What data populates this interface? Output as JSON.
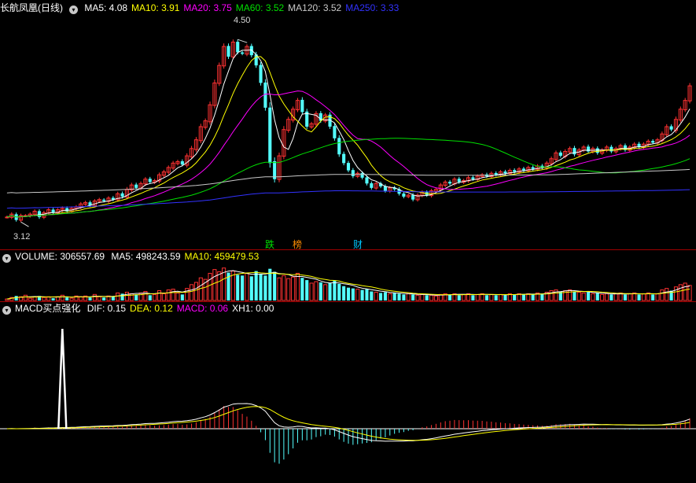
{
  "price_header": {
    "title": "长航凤凰(日线)",
    "items": [
      {
        "label": "MA5: 4.08",
        "color": "#ffffff"
      },
      {
        "label": "MA10: 3.91",
        "color": "#ffff00"
      },
      {
        "label": "MA20: 3.75",
        "color": "#ff00ff"
      },
      {
        "label": "MA60: 3.52",
        "color": "#00e000"
      },
      {
        "label": "MA120: 3.52",
        "color": "#c8c8c8"
      },
      {
        "label": "MA250: 3.33",
        "color": "#3232ff"
      }
    ]
  },
  "volume_header": {
    "title": "VOLUME: 306557.69",
    "items": [
      {
        "label": "MA5: 498243.59",
        "color": "#ffffff"
      },
      {
        "label": "MA10: 459479.53",
        "color": "#ffff00"
      }
    ]
  },
  "macd_header": {
    "title": "MACD买点强化",
    "items": [
      {
        "label": "DIF: 0.15",
        "color": "#ffffff"
      },
      {
        "label": "DEA: 0.12",
        "color": "#ffff00"
      },
      {
        "label": "MACD: 0.06",
        "color": "#ff00ff"
      },
      {
        "label": "XH1: 0.00",
        "color": "#ffffff"
      }
    ]
  },
  "annotations": {
    "high": "4.50",
    "low": "3.12"
  },
  "events": [
    {
      "label": "跌",
      "color": "#00e000",
      "day": 57
    },
    {
      "label": "榜",
      "color": "#ff8c00",
      "day": 63
    },
    {
      "label": "财",
      "color": "#00c8ff",
      "day": 76
    }
  ],
  "colors": {
    "up": "#ff3232",
    "down": "#54ffff",
    "grid": "#a00000"
  },
  "chart_data": {
    "type": "candlestick",
    "seed": [
      [
        3.18,
        0,
        0.2,
        0,
        0
      ],
      [
        3.2,
        0.3,
        0.4,
        0,
        0
      ],
      [
        3.16,
        -0.2,
        0.6,
        0,
        0
      ],
      [
        3.19,
        0.3,
        0.5,
        0,
        0
      ],
      [
        3.19,
        0,
        0.7,
        0,
        0
      ],
      [
        3.2,
        0.2,
        0.3,
        0,
        0
      ],
      [
        3.22,
        0.3,
        0.5,
        0,
        0
      ],
      [
        3.18,
        -0.3,
        0.6,
        0,
        0
      ],
      [
        3.21,
        0.3,
        0.4,
        0,
        0
      ],
      [
        3.23,
        0.4,
        0.5,
        0,
        0
      ],
      [
        3.21,
        -0.2,
        0.3,
        0,
        0
      ],
      [
        3.23,
        0.2,
        0.5,
        0,
        0
      ],
      [
        3.24,
        0.3,
        0.7,
        0,
        0
      ],
      [
        3.22,
        -0.2,
        0.4,
        0,
        0
      ],
      [
        3.24,
        0.3,
        0.3,
        0,
        0
      ],
      [
        3.25,
        0.2,
        0.6,
        0,
        0
      ],
      [
        3.27,
        0.3,
        0.5,
        0,
        0
      ],
      [
        3.28,
        0.2,
        0.6,
        0,
        0
      ],
      [
        3.26,
        -0.2,
        0.4,
        0,
        0
      ],
      [
        3.29,
        0.3,
        0.8,
        0,
        0
      ],
      [
        3.3,
        0.2,
        0.5,
        0,
        0
      ],
      [
        3.29,
        0,
        0.4,
        0,
        0
      ],
      [
        3.31,
        0.3,
        0.6,
        0,
        0
      ],
      [
        3.3,
        -0.2,
        0.5,
        0,
        0
      ],
      [
        3.34,
        0.4,
        1.0,
        0,
        0
      ],
      [
        3.32,
        -0.3,
        0.9,
        0,
        0
      ],
      [
        3.37,
        0.6,
        1.1,
        0,
        0
      ],
      [
        3.4,
        0.5,
        0.9,
        0,
        0
      ],
      [
        3.38,
        -0.3,
        0.8,
        0,
        0
      ],
      [
        3.41,
        0.4,
        1.0,
        0,
        0
      ],
      [
        3.44,
        0.4,
        1.2,
        0,
        0
      ],
      [
        3.42,
        -0.3,
        0.7,
        0,
        0
      ],
      [
        3.43,
        0.2,
        0.8,
        0,
        0
      ],
      [
        3.47,
        0.5,
        1.3,
        0,
        0
      ],
      [
        3.49,
        0.4,
        0.9,
        0,
        0
      ],
      [
        3.52,
        0.4,
        1.4,
        0,
        0
      ],
      [
        3.55,
        0.5,
        1.5,
        0,
        0
      ],
      [
        3.56,
        0.3,
        1.0,
        0,
        0
      ],
      [
        3.54,
        -0.3,
        0.8,
        0,
        0
      ],
      [
        3.6,
        0.7,
        1.6,
        0,
        0
      ],
      [
        3.65,
        0.8,
        2.1,
        0,
        0
      ],
      [
        3.71,
        0.9,
        2.4,
        0,
        0
      ],
      [
        3.8,
        1.0,
        3.0,
        0,
        0
      ],
      [
        3.84,
        0.6,
        2.8,
        0,
        0
      ],
      [
        3.95,
        1.2,
        3.6,
        0,
        0
      ],
      [
        4.1,
        1.3,
        4.1,
        0,
        0
      ],
      [
        4.22,
        1.0,
        3.8,
        0,
        0
      ],
      [
        4.35,
        1.1,
        4.3,
        0,
        0
      ],
      [
        4.28,
        -0.7,
        3.7,
        0,
        0
      ],
      [
        4.38,
        0.8,
        3.9,
        0,
        0
      ],
      [
        4.31,
        -0.6,
        3.4,
        0,
        0
      ],
      [
        4.3,
        0,
        3.3,
        0,
        0
      ],
      [
        4.35,
        0.5,
        3.6,
        0,
        0
      ],
      [
        4.29,
        -0.6,
        3.2,
        0,
        0
      ],
      [
        4.22,
        -0.8,
        3.9,
        0,
        0
      ],
      [
        4.1,
        -1.0,
        3.5,
        0,
        0
      ],
      [
        3.93,
        -1.3,
        3.3,
        0,
        0
      ],
      [
        3.55,
        -2.6,
        4.2,
        0,
        0
      ],
      [
        3.44,
        -1.6,
        3.8,
        0,
        0
      ],
      [
        3.6,
        1.2,
        3.0,
        0,
        0
      ],
      [
        3.78,
        1.4,
        3.3,
        0,
        0
      ],
      [
        3.85,
        0.8,
        2.9,
        0,
        0
      ],
      [
        3.92,
        0.8,
        3.1,
        0,
        0
      ],
      [
        3.98,
        0.7,
        3.6,
        0,
        0
      ],
      [
        3.9,
        -0.8,
        3.0,
        0,
        0
      ],
      [
        3.8,
        -0.9,
        2.7,
        0,
        0
      ],
      [
        3.82,
        0.3,
        2.3,
        0,
        0
      ],
      [
        3.89,
        0.7,
        2.5,
        0,
        0
      ],
      [
        3.84,
        -0.5,
        2.4,
        0,
        0
      ],
      [
        3.88,
        0.4,
        2.1,
        0,
        0
      ],
      [
        3.8,
        -0.7,
        2.3,
        0,
        0
      ],
      [
        3.72,
        -0.8,
        2.6,
        0,
        0
      ],
      [
        3.61,
        -0.9,
        2.2,
        0,
        0
      ],
      [
        3.55,
        -0.6,
        1.9,
        0,
        0
      ],
      [
        3.5,
        -0.4,
        1.7,
        0,
        0
      ],
      [
        3.46,
        -0.4,
        1.6,
        0,
        0
      ],
      [
        3.48,
        0.2,
        1.5,
        0,
        0
      ],
      [
        3.45,
        -0.3,
        1.4,
        0,
        0
      ],
      [
        3.41,
        -0.4,
        1.5,
        0,
        0
      ],
      [
        3.38,
        -0.3,
        1.2,
        0,
        0
      ],
      [
        3.41,
        0.3,
        1.1,
        0,
        0
      ],
      [
        3.39,
        -0.2,
        1.0,
        0,
        0
      ],
      [
        3.36,
        -0.3,
        1.1,
        0,
        0
      ],
      [
        3.38,
        0.3,
        0.9,
        0,
        0
      ],
      [
        3.37,
        -0.2,
        1.0,
        0,
        0
      ],
      [
        3.34,
        -0.3,
        0.9,
        0,
        0
      ],
      [
        3.32,
        -0.2,
        0.8,
        0,
        0
      ],
      [
        3.33,
        0.1,
        0.9,
        0,
        0
      ],
      [
        3.3,
        -0.3,
        0.8,
        0,
        0
      ],
      [
        3.33,
        0.3,
        0.7,
        0,
        0
      ],
      [
        3.35,
        0.3,
        0.8,
        0,
        0
      ],
      [
        3.33,
        -0.2,
        0.7,
        0,
        0
      ],
      [
        3.36,
        0.4,
        0.7,
        0,
        0
      ],
      [
        3.37,
        0.3,
        0.6,
        0,
        0
      ],
      [
        3.4,
        0.4,
        0.8,
        0,
        0
      ],
      [
        3.42,
        0.3,
        0.9,
        0,
        0
      ],
      [
        3.41,
        -0.2,
        0.8,
        0,
        0
      ],
      [
        3.44,
        0.4,
        0.9,
        0,
        0
      ],
      [
        3.42,
        -0.3,
        0.7,
        0,
        0
      ],
      [
        3.43,
        0.2,
        0.8,
        0,
        0
      ],
      [
        3.45,
        0.3,
        0.9,
        0,
        0
      ],
      [
        3.44,
        -0.2,
        0.7,
        0,
        0
      ],
      [
        3.46,
        0.3,
        0.8,
        0,
        0
      ],
      [
        3.47,
        0.2,
        0.9,
        0,
        0
      ],
      [
        3.46,
        -0.2,
        0.7,
        0,
        0
      ],
      [
        3.48,
        0.3,
        0.8,
        0,
        0
      ],
      [
        3.47,
        -0.2,
        0.7,
        0,
        0
      ],
      [
        3.49,
        0.3,
        0.8,
        0,
        0
      ],
      [
        3.48,
        -0.2,
        0.7,
        0,
        0
      ],
      [
        3.5,
        0.3,
        0.9,
        0,
        0
      ],
      [
        3.49,
        -0.2,
        0.8,
        0,
        0
      ],
      [
        3.51,
        0.3,
        0.9,
        0,
        0
      ],
      [
        3.5,
        -0.2,
        0.8,
        0,
        0
      ],
      [
        3.52,
        0.3,
        0.9,
        0,
        0
      ],
      [
        3.51,
        -0.2,
        0.8,
        0,
        0
      ],
      [
        3.53,
        0.3,
        1.0,
        0,
        0
      ],
      [
        3.52,
        -0.2,
        0.9,
        0,
        0
      ],
      [
        3.55,
        0.4,
        1.1,
        0,
        0
      ],
      [
        3.58,
        0.5,
        1.3,
        0,
        0
      ],
      [
        3.62,
        0.6,
        1.4,
        0,
        0
      ],
      [
        3.6,
        -0.3,
        1.2,
        0,
        0
      ],
      [
        3.63,
        0.5,
        1.3,
        0,
        0
      ],
      [
        3.65,
        0.4,
        1.4,
        0,
        0
      ],
      [
        3.61,
        -0.5,
        1.2,
        0,
        0
      ],
      [
        3.64,
        0.4,
        1.1,
        0,
        0
      ],
      [
        3.66,
        0.3,
        1.0,
        0,
        0
      ],
      [
        3.63,
        -0.4,
        1.1,
        0,
        0
      ],
      [
        3.65,
        0.3,
        0.9,
        0,
        0
      ],
      [
        3.62,
        -0.3,
        1.0,
        0,
        0
      ],
      [
        3.64,
        0.3,
        0.8,
        0,
        0
      ],
      [
        3.66,
        0.3,
        0.9,
        0,
        0
      ],
      [
        3.63,
        -0.3,
        0.8,
        0,
        0
      ],
      [
        3.65,
        0.3,
        0.9,
        0,
        0
      ],
      [
        3.67,
        0.3,
        1.0,
        0,
        0
      ],
      [
        3.64,
        -0.3,
        0.8,
        0,
        0
      ],
      [
        3.66,
        0.3,
        0.9,
        0,
        0
      ],
      [
        3.68,
        0.4,
        1.0,
        0,
        0
      ],
      [
        3.66,
        -0.3,
        0.8,
        0,
        0
      ],
      [
        3.68,
        0.3,
        0.9,
        0,
        0
      ],
      [
        3.7,
        0.3,
        1.0,
        0,
        0
      ],
      [
        3.69,
        -0.2,
        0.8,
        0,
        0
      ],
      [
        3.71,
        0.3,
        0.9,
        0,
        0
      ],
      [
        3.75,
        0.6,
        1.4,
        0,
        0
      ],
      [
        3.8,
        0.7,
        1.6,
        0,
        0
      ],
      [
        3.78,
        -0.3,
        1.3,
        0,
        0
      ],
      [
        3.85,
        0.9,
        1.8,
        0,
        0
      ],
      [
        3.92,
        0.8,
        2.1,
        0,
        0
      ],
      [
        3.98,
        0.7,
        2.3,
        0,
        0
      ],
      [
        4.08,
        0.9,
        2.0,
        0,
        0
      ]
    ],
    "price_range": [
      3.05,
      4.55
    ],
    "high": 4.5,
    "low": 3.12,
    "volume_max": 5.0,
    "macd_range": [
      -0.3,
      0.55
    ]
  }
}
